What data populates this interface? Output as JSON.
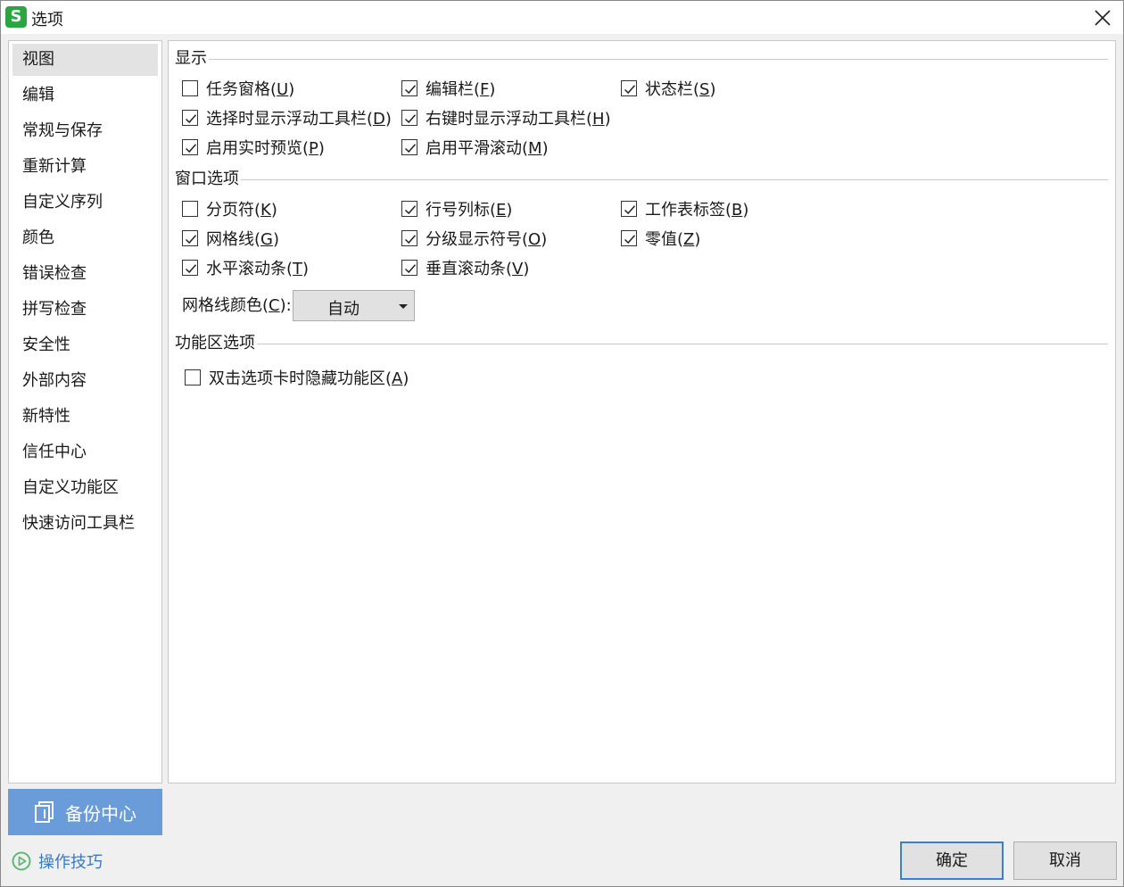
{
  "window": {
    "title": "选项",
    "app_icon_glyph": "S",
    "app_icon_color": "#2aa641"
  },
  "sidebar": {
    "selected_index": 0,
    "items": [
      {
        "label": "视图"
      },
      {
        "label": "编辑"
      },
      {
        "label": "常规与保存"
      },
      {
        "label": "重新计算"
      },
      {
        "label": "自定义序列"
      },
      {
        "label": "颜色"
      },
      {
        "label": "错误检查"
      },
      {
        "label": "拼写检查"
      },
      {
        "label": "安全性"
      },
      {
        "label": "外部内容"
      },
      {
        "label": "新特性"
      },
      {
        "label": "信任中心"
      },
      {
        "label": "自定义功能区"
      },
      {
        "label": "快速访问工具栏"
      }
    ]
  },
  "sections": {
    "display": {
      "title": "显示",
      "options": [
        {
          "label": "任务窗格(",
          "key": "U",
          "suffix": ")",
          "checked": false
        },
        {
          "label": "编辑栏(",
          "key": "F",
          "suffix": ")",
          "checked": true
        },
        {
          "label": "状态栏(",
          "key": "S",
          "suffix": ")",
          "checked": true
        },
        {
          "label": "选择时显示浮动工具栏(",
          "key": "D",
          "suffix": ")",
          "checked": true
        },
        {
          "label": "右键时显示浮动工具栏(",
          "key": "H",
          "suffix": ")",
          "checked": true
        },
        {
          "label": "启用实时预览(",
          "key": "P",
          "suffix": ")",
          "checked": true
        },
        {
          "label": "启用平滑滚动(",
          "key": "M",
          "suffix": ")",
          "checked": true
        }
      ]
    },
    "window_options": {
      "title": "窗口选项",
      "options": [
        {
          "label": "分页符(",
          "key": "K",
          "suffix": ")",
          "checked": false
        },
        {
          "label": "行号列标(",
          "key": "E",
          "suffix": ")",
          "checked": true
        },
        {
          "label": "工作表标签(",
          "key": "B",
          "suffix": ")",
          "checked": true
        },
        {
          "label": "网格线(",
          "key": "G",
          "suffix": ")",
          "checked": true
        },
        {
          "label": "分级显示符号(",
          "key": "O",
          "suffix": ")",
          "checked": true
        },
        {
          "label": "零值(",
          "key": "Z",
          "suffix": ")",
          "checked": true
        },
        {
          "label": "水平滚动条(",
          "key": "T",
          "suffix": ")",
          "checked": true
        },
        {
          "label": "垂直滚动条(",
          "key": "V",
          "suffix": ")",
          "checked": true
        }
      ],
      "gridline_color": {
        "label": "网格线颜色(",
        "key": "C",
        "suffix": "):",
        "value": "自动"
      }
    },
    "ribbon": {
      "title": "功能区选项",
      "options": [
        {
          "label": "双击选项卡时隐藏功能区(",
          "key": "A",
          "suffix": ")",
          "checked": false
        }
      ]
    }
  },
  "footer": {
    "backup_label": "备份中心",
    "tips_label": "操作技巧",
    "ok_label": "确定",
    "cancel_label": "取消",
    "accent_color": "#6a9cd9",
    "link_color": "#3a78c8"
  }
}
